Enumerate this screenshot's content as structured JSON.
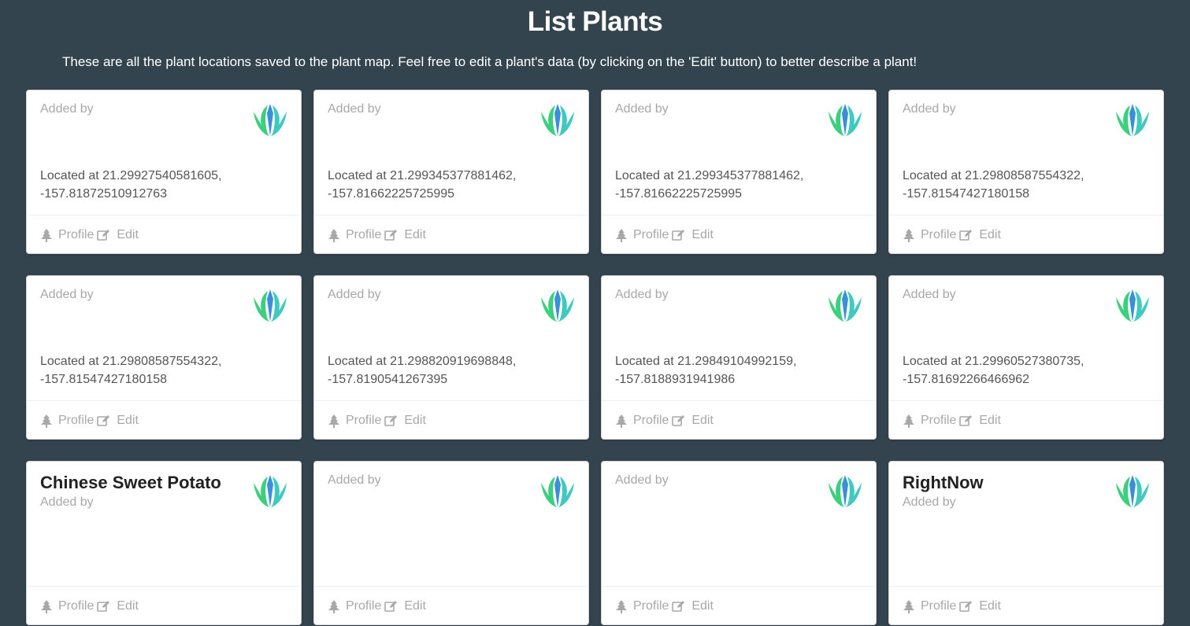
{
  "header": {
    "title": "List Plants",
    "description": "These are all the plant locations saved to the plant map. Feel free to edit a plant's data (by clicking on the 'Edit' button) to better describe a plant!"
  },
  "colors": {
    "background": "#34444f",
    "card": "#ffffff",
    "muted_text": "#a8a8a8",
    "logo_green": "#3ccf7e",
    "logo_teal": "#3fc9c0",
    "logo_blue": "#3a8fd8"
  },
  "icons": {
    "logo": "lotus-leaf-icon",
    "profile": "tree-icon",
    "edit": "edit-icon"
  },
  "cards": [
    {
      "name": "",
      "added_by": "Added by",
      "location_line1": "Located at 21.29927540581605,",
      "location_line2": "-157.81872510912763",
      "profile_label": "Profile",
      "edit_label": "Edit"
    },
    {
      "name": "",
      "added_by": "Added by",
      "location_line1": "Located at 21.299345377881462,",
      "location_line2": "-157.81662225725995",
      "profile_label": "Profile",
      "edit_label": "Edit"
    },
    {
      "name": "",
      "added_by": "Added by",
      "location_line1": "Located at 21.299345377881462,",
      "location_line2": "-157.81662225725995",
      "profile_label": "Profile",
      "edit_label": "Edit"
    },
    {
      "name": "",
      "added_by": "Added by",
      "location_line1": "Located at 21.29808587554322,",
      "location_line2": "-157.81547427180158",
      "profile_label": "Profile",
      "edit_label": "Edit"
    },
    {
      "name": "",
      "added_by": "Added by",
      "location_line1": "Located at 21.29808587554322,",
      "location_line2": "-157.81547427180158",
      "profile_label": "Profile",
      "edit_label": "Edit"
    },
    {
      "name": "",
      "added_by": "Added by",
      "location_line1": "Located at 21.298820919698848,",
      "location_line2": "-157.8190541267395",
      "profile_label": "Profile",
      "edit_label": "Edit"
    },
    {
      "name": "",
      "added_by": "Added by",
      "location_line1": "Located at 21.29849104992159,",
      "location_line2": "-157.8188931941986",
      "profile_label": "Profile",
      "edit_label": "Edit"
    },
    {
      "name": "",
      "added_by": "Added by",
      "location_line1": "Located at 21.29960527380735,",
      "location_line2": "-157.81692266466962",
      "profile_label": "Profile",
      "edit_label": "Edit"
    },
    {
      "name": "Chinese Sweet Potato",
      "added_by": "Added by",
      "location_line1": "",
      "location_line2": "",
      "profile_label": "Profile",
      "edit_label": "Edit"
    },
    {
      "name": "",
      "added_by": "Added by",
      "location_line1": "",
      "location_line2": "",
      "profile_label": "Profile",
      "edit_label": "Edit"
    },
    {
      "name": "",
      "added_by": "Added by",
      "location_line1": "",
      "location_line2": "",
      "profile_label": "Profile",
      "edit_label": "Edit"
    },
    {
      "name": "RightNow",
      "added_by": "Added by",
      "location_line1": "",
      "location_line2": "",
      "profile_label": "Profile",
      "edit_label": "Edit"
    }
  ]
}
